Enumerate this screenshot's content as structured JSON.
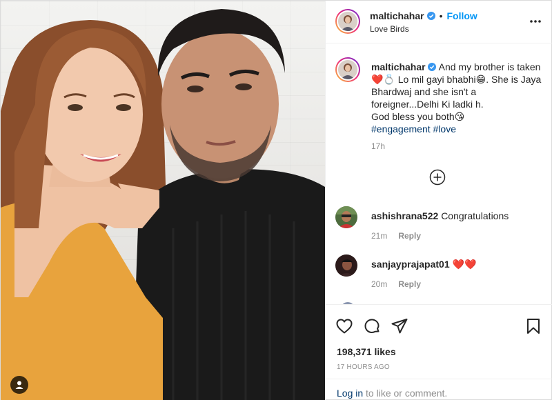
{
  "header": {
    "username": "maltichahar",
    "separator": "•",
    "follow_label": "Follow",
    "location": "Love Birds"
  },
  "caption": {
    "username": "maltichahar",
    "text_line1": "And my brother is taken",
    "text_line2": "❤️💍 Lo mil gayi bhabhi😁. She is Jaya Bhardwaj and she isn't a foreigner...Delhi Ki ladki h.",
    "text_line3": "God bless you both😘",
    "hashtags": [
      "#engagement",
      "#love"
    ],
    "time": "17h"
  },
  "comments": [
    {
      "username": "ashishrana522",
      "text": "Congratulations",
      "time": "21m",
      "reply_label": "Reply"
    },
    {
      "username": "sanjayprajapat01",
      "text": "❤️❤️",
      "time": "20m",
      "reply_label": "Reply"
    }
  ],
  "stats": {
    "likes": "198,371 likes",
    "posted": "17 HOURS AGO"
  },
  "login": {
    "link": "Log in",
    "rest": " to like or comment."
  },
  "icons": {
    "verified": "verified-badge-icon",
    "more": "more-options-icon",
    "load_more": "plus-circle-icon",
    "like": "heart-icon",
    "comment": "speech-bubble-icon",
    "share": "paper-plane-icon",
    "save": "bookmark-icon",
    "tag": "user-tag-icon"
  },
  "colors": {
    "accent": "#0095f6",
    "hashtag": "#00376b",
    "muted": "#8e8e8e",
    "verified": "#3897f0"
  }
}
